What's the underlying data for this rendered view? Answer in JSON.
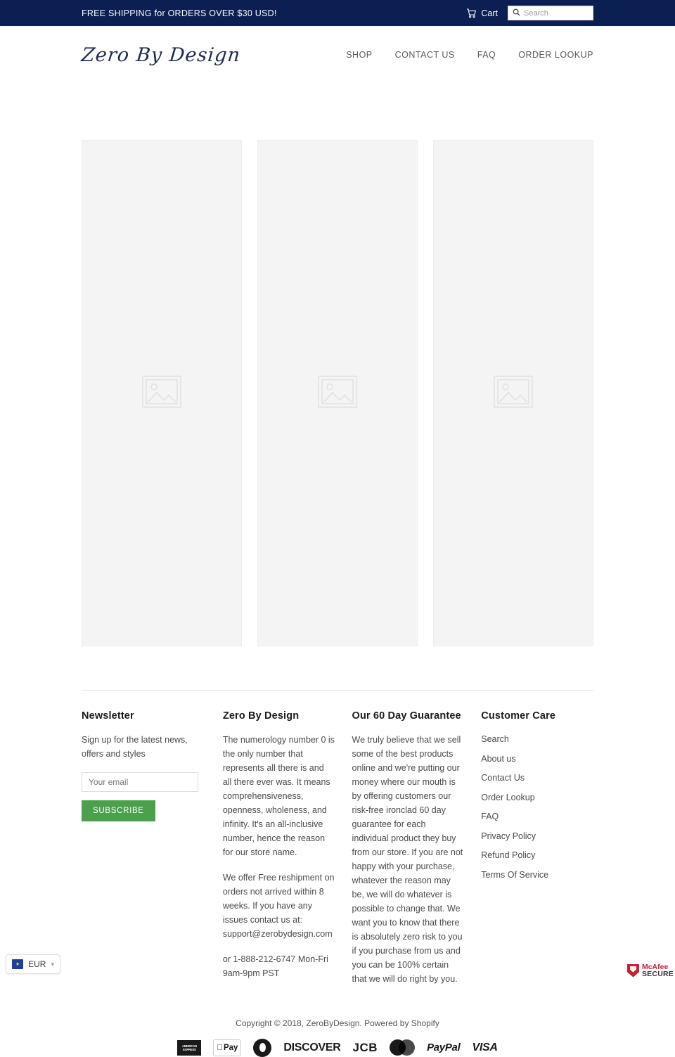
{
  "announcement": {
    "text": "FREE SHIPPING for ORDERS OVER $30 USD!",
    "cart_label": "Cart",
    "cart_icon": "shopping-cart-icon",
    "search_icon": "search-icon",
    "search_placeholder": "Search"
  },
  "header": {
    "logo_text": "Zero By Design",
    "nav": [
      {
        "label": "SHOP"
      },
      {
        "label": "CONTACT US"
      },
      {
        "label": "FAQ"
      },
      {
        "label": "ORDER LOOKUP"
      }
    ]
  },
  "products": [
    {
      "placeholder_icon": "image-placeholder-icon"
    },
    {
      "placeholder_icon": "image-placeholder-icon"
    },
    {
      "placeholder_icon": "image-placeholder-icon"
    }
  ],
  "footer": {
    "newsletter": {
      "heading": "Newsletter",
      "description": "Sign up for the latest news, offers and styles",
      "email_placeholder": "Your email",
      "subscribe_label": "SUBSCRIBE"
    },
    "about": {
      "heading": "Zero By Design",
      "paragraph1": "The numerology number 0 is the only number that represents all there is and all there ever was. It means comprehensiveness, openness, wholeness, and infinity. It's an all-inclusive number, hence the reason for our store name.",
      "paragraph2": "We offer Free reshipment on orders not arrived within 8 weeks. If you have any issues contact us at: support@zerobydesign.com",
      "paragraph3": "or  1-888-212-6747 Mon-Fri 9am-9pm PST"
    },
    "guarantee": {
      "heading": "Our 60 Day Guarantee",
      "paragraph": "We truly believe that we sell some of the best products online and we're putting our money where our mouth is by offering customers our risk-free ironclad 60 day guarantee for each individual product they buy from our store. If you are not happy with your purchase, whatever the reason may be, we will do whatever is possible to change that. We want you to know that there is absolutely zero risk to you if you purchase from us and you can be 100% certain that we will do right by you."
    },
    "customer_care": {
      "heading": "Customer Care",
      "links": [
        {
          "label": "Search"
        },
        {
          "label": "About us"
        },
        {
          "label": "Contact Us"
        },
        {
          "label": "Order Lookup"
        },
        {
          "label": "FAQ"
        },
        {
          "label": "Privacy Policy"
        },
        {
          "label": "Refund Policy"
        },
        {
          "label": "Terms Of Service"
        }
      ]
    },
    "copyright": "Copyright © 2018, ZeroByDesign. Powered by Shopify",
    "payment_methods": [
      {
        "name": "american-express",
        "label": "AMERICAN EXPRESS"
      },
      {
        "name": "apple-pay",
        "label": "Pay"
      },
      {
        "name": "diners-club",
        "label": "Diners Club"
      },
      {
        "name": "discover",
        "label": "DISCOVER"
      },
      {
        "name": "jcb",
        "label": "JCB"
      },
      {
        "name": "mastercard",
        "label": "Mastercard"
      },
      {
        "name": "paypal",
        "label": "PayPal"
      },
      {
        "name": "visa",
        "label": "VISA"
      }
    ]
  },
  "currency_selector": {
    "code": "EUR",
    "flag": "eu-flag-icon",
    "chevron": "▾"
  },
  "trust_badge": {
    "line1": "McAfee",
    "line2": "SECURE"
  },
  "colors": {
    "navy": "#0b1f52",
    "green": "#4ba04b",
    "card_bg": "#f4f4f4",
    "mcafee_red": "#c8202e"
  }
}
